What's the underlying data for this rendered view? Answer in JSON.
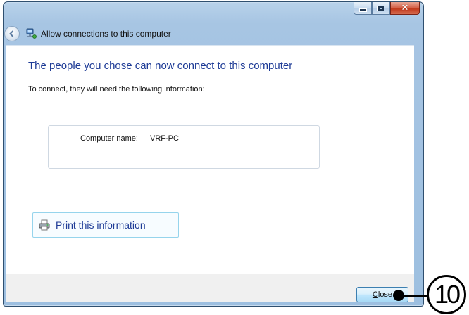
{
  "window": {
    "title": "Allow connections to this computer",
    "controls": {
      "minimize_icon": "minimize-icon",
      "maximize_icon": "maximize-icon",
      "close_glyph": "✕"
    }
  },
  "main": {
    "heading": "The people you chose can now connect to this computer",
    "subtext": "To connect, they will need the following information:",
    "info": {
      "label": "Computer name:",
      "value": "VRF-PC"
    },
    "print_button": {
      "label": "Print this information",
      "icon": "printer-icon"
    }
  },
  "footer": {
    "close_button": {
      "accesskey_letter": "C",
      "rest": "lose"
    }
  },
  "annotation": {
    "callout_number": "10"
  },
  "colors": {
    "heading": "#1e3b96",
    "frame": "#a7c5e3",
    "close_control": "#c2391c",
    "footer": "#f0f0f0"
  }
}
